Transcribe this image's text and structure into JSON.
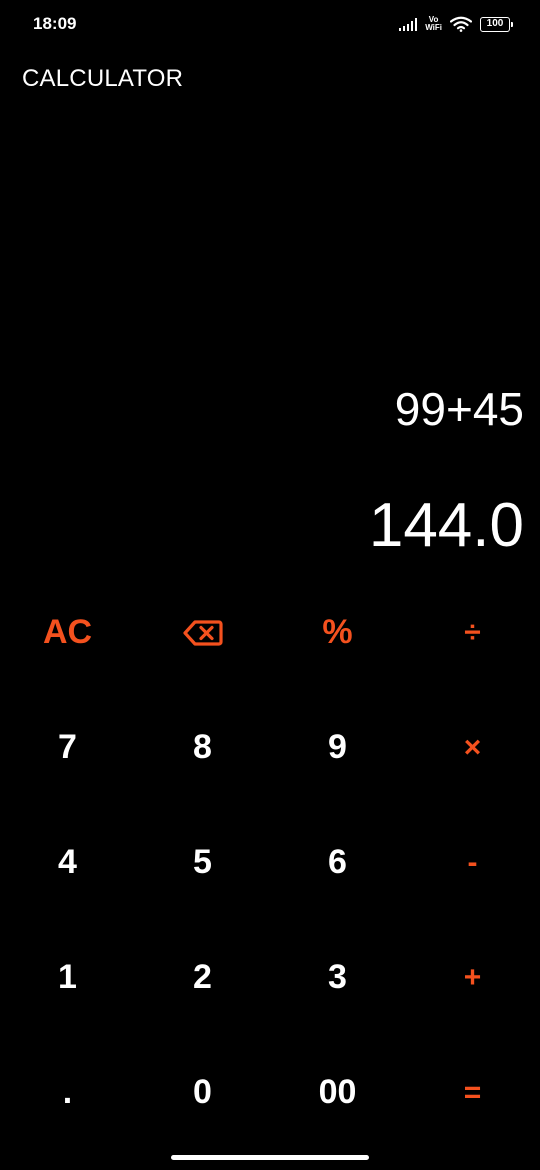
{
  "status_bar": {
    "time": "18:09",
    "signal_icon": "cellular-signal-icon",
    "vowifi_top": "Vo",
    "vowifi_bottom": "WiFi",
    "wifi_icon": "wifi-icon",
    "battery_level": "100"
  },
  "app": {
    "title": "CALCULATOR"
  },
  "display": {
    "expression": "99+45",
    "result": "144.0"
  },
  "keys": {
    "ac": "AC",
    "backspace_icon": "backspace-icon",
    "percent": "%",
    "divide": "÷",
    "seven": "7",
    "eight": "8",
    "nine": "9",
    "multiply": "×",
    "four": "4",
    "five": "5",
    "six": "6",
    "minus": "-",
    "one": "1",
    "two": "2",
    "three": "3",
    "plus": "+",
    "dot": ".",
    "zero": "0",
    "double_zero": "00",
    "equals": "="
  },
  "colors": {
    "background": "#000000",
    "accent": "#f4511e",
    "text": "#ffffff"
  }
}
